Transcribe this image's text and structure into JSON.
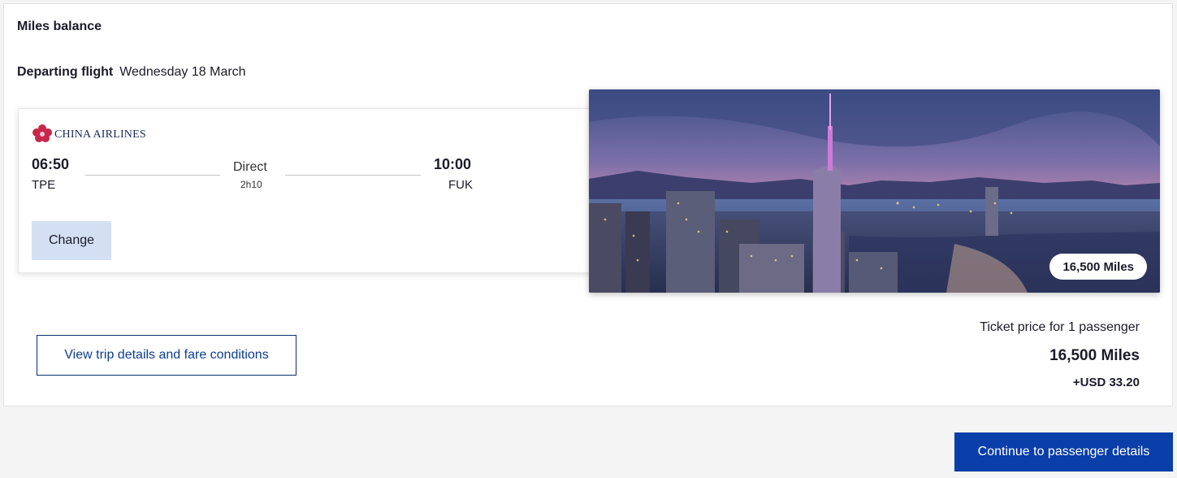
{
  "header": {
    "miles_balance_label": "Miles balance",
    "departing_label": "Departing flight",
    "departing_date": "Wednesday 18 March"
  },
  "flight": {
    "airline": "CHINA AIRLINES",
    "departure_time": "06:50",
    "departure_code": "TPE",
    "stops": "Direct",
    "duration": "2h10",
    "arrival_time": "10:00",
    "arrival_code": "FUK",
    "change_label": "Change"
  },
  "destination": {
    "miles_badge": "16,500 Miles"
  },
  "actions": {
    "trip_details_label": "View trip details and fare conditions",
    "continue_label": "Continue to passenger details"
  },
  "price": {
    "label": "Ticket price for 1 passenger",
    "miles": "16,500 Miles",
    "usd": "+USD 33.20"
  },
  "colors": {
    "primary": "#0a3ea8",
    "change_button_bg": "#d3e0f3",
    "airline_logo": "#c8264a"
  },
  "icons": {
    "airline_logo": "plum-blossom-logo"
  }
}
